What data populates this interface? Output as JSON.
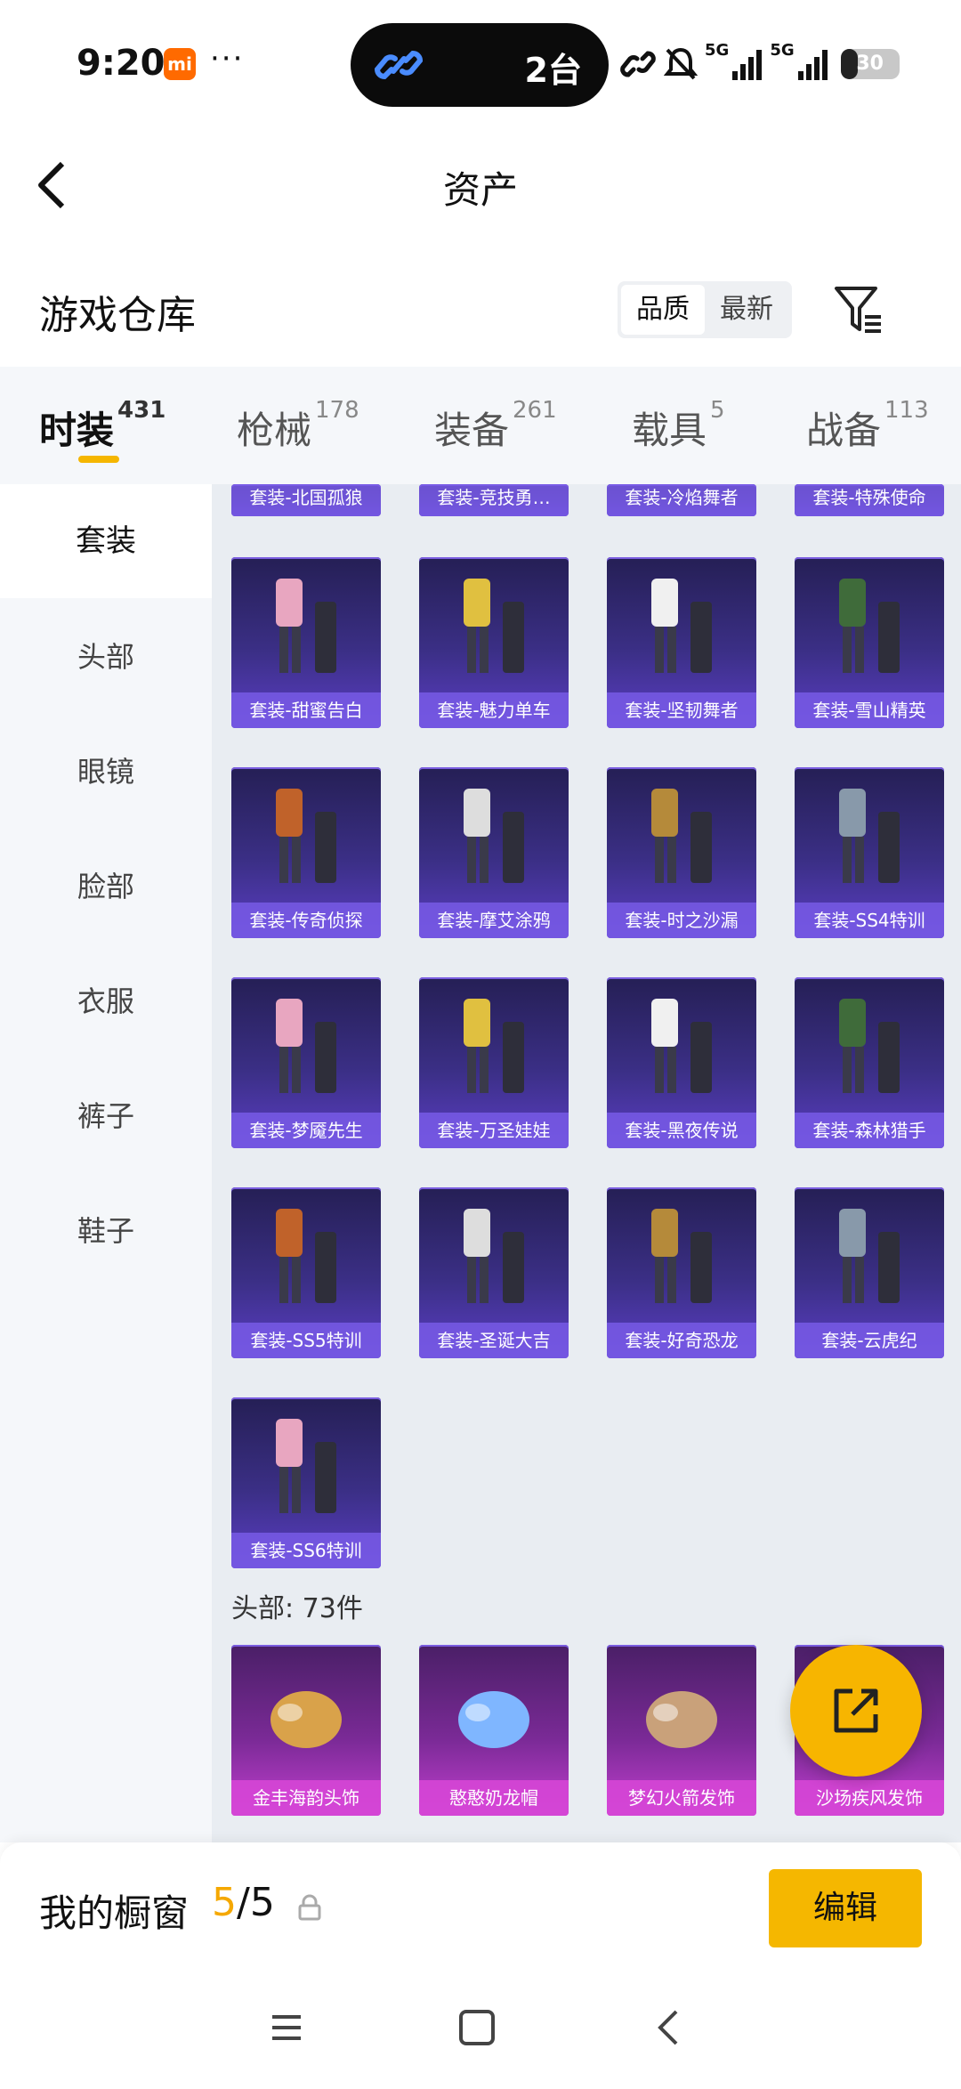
{
  "status_bar": {
    "time": "9:20",
    "mi_badge": "mi",
    "dots": "···",
    "island_text": "2台",
    "signal1": "5G",
    "signal2": "5G",
    "battery": "30",
    "battery_level": 0.3
  },
  "header": {
    "title": "资产"
  },
  "section": {
    "title": "游戏仓库",
    "sort_options": [
      "品质",
      "最新"
    ],
    "active_sort": "品质"
  },
  "tabs": [
    {
      "label": "时装",
      "count": "431",
      "active": true
    },
    {
      "label": "枪械",
      "count": "178"
    },
    {
      "label": "装备",
      "count": "261"
    },
    {
      "label": "载具",
      "count": "5"
    },
    {
      "label": "战备",
      "count": "113"
    }
  ],
  "sidebar": {
    "items": [
      "套装",
      "头部",
      "眼镜",
      "脸部",
      "衣服",
      "裤子",
      "鞋子"
    ],
    "active": "套装"
  },
  "content": {
    "partial_row": [
      "套装-北国孤狼",
      "套装-竞技勇…",
      "套装-冷焰舞者",
      "套装-特殊使命"
    ],
    "suit_rows": [
      [
        "套装-甜蜜告白",
        "套装-魅力单车",
        "套装-坚韧舞者",
        "套装-雪山精英"
      ],
      [
        "套装-传奇侦探",
        "套装-摩艾涂鸦",
        "套装-时之沙漏",
        "套装-SS4特训"
      ],
      [
        "套装-梦魇先生",
        "套装-万圣娃娃",
        "套装-黑夜传说",
        "套装-森林猎手"
      ],
      [
        "套装-SS5特训",
        "套装-圣诞大吉",
        "套装-好奇恐龙",
        "套装-云虎纪"
      ],
      [
        "套装-SS6特训"
      ]
    ],
    "head_heading": "头部: 73件",
    "head_row": [
      "金丰海韵头饰",
      "憨憨奶龙帽",
      "梦幻火箭发饰",
      "沙场疾风发饰"
    ]
  },
  "bottom_bar": {
    "title": "我的橱窗",
    "count_current": "5",
    "count_total": "/5",
    "edit_label": "编辑"
  },
  "colors": {
    "accent": "#f5b700",
    "suit_card": "#3b2f86",
    "head_card": "#c23fcf"
  }
}
